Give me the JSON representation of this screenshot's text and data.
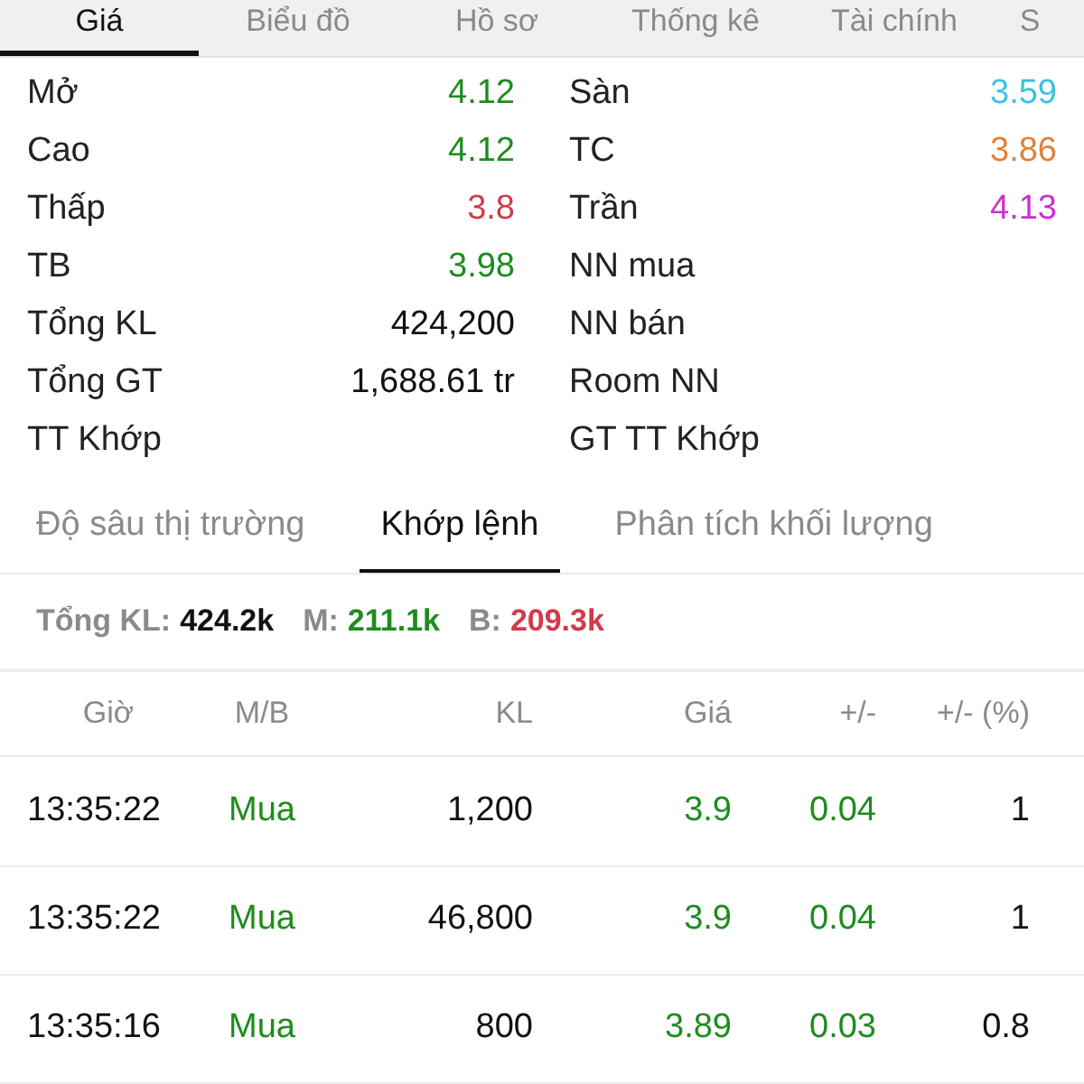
{
  "top_tabs": [
    {
      "label": "Giá",
      "selected": true
    },
    {
      "label": "Biểu đồ",
      "selected": false
    },
    {
      "label": "Hồ sơ",
      "selected": false
    },
    {
      "label": "Thống kê",
      "selected": false
    },
    {
      "label": "Tài chính",
      "selected": false
    },
    {
      "label": "S",
      "selected": false
    }
  ],
  "stats_left": [
    {
      "label": "Mở",
      "value": "4.12",
      "color": "#1e8c1e"
    },
    {
      "label": "Cao",
      "value": "4.12",
      "color": "#1e8c1e"
    },
    {
      "label": "Thấp",
      "value": "3.8",
      "color": "#d23a4a"
    },
    {
      "label": "TB",
      "value": "3.98",
      "color": "#1e8c1e"
    },
    {
      "label": "Tổng KL",
      "value": "424,200",
      "color": "#111111"
    },
    {
      "label": "Tổng GT",
      "value": "1,688.61 tr",
      "color": "#111111"
    },
    {
      "label": "TT Khớp"
    }
  ],
  "stats_right": [
    {
      "label": "Sàn",
      "value": "3.59",
      "color": "#3cc3e0"
    },
    {
      "label": "TC",
      "value": "3.86",
      "color": "#e0803a"
    },
    {
      "label": "Trần",
      "value": "4.13",
      "color": "#cc2fd0"
    },
    {
      "label": "NN mua"
    },
    {
      "label": "NN bán"
    },
    {
      "label": "Room NN"
    },
    {
      "label": "GT TT Khớp"
    }
  ],
  "sub_tabs": [
    {
      "label": "Độ sâu thị trường",
      "selected": false
    },
    {
      "label": "Khớp lệnh",
      "selected": true
    },
    {
      "label": "Phân tích khối lượng",
      "selected": false
    }
  ],
  "summary": [
    {
      "label": "Tổng KL:",
      "value": "424.2k",
      "color": "#111111"
    },
    {
      "label": "M:",
      "value": "211.1k",
      "color": "#1e8c1e"
    },
    {
      "label": "B:",
      "value": "209.3k",
      "color": "#d23a4a"
    }
  ],
  "table": {
    "columns": [
      "Giờ",
      "M/B",
      "KL",
      "Giá",
      "+/-",
      "+/- (%)"
    ],
    "rows": [
      {
        "time": "13:35:22",
        "side": "Mua",
        "volume": "1,200",
        "price": "3.9",
        "change": "0.04",
        "percent": "1",
        "color": "#1e8c1e"
      },
      {
        "time": "13:35:22",
        "side": "Mua",
        "volume": "46,800",
        "price": "3.9",
        "change": "0.04",
        "percent": "1",
        "color": "#1e8c1e"
      },
      {
        "time": "13:35:16",
        "side": "Mua",
        "volume": "800",
        "price": "3.89",
        "change": "0.03",
        "percent": "0.8",
        "color": "#1e8c1e"
      }
    ]
  }
}
